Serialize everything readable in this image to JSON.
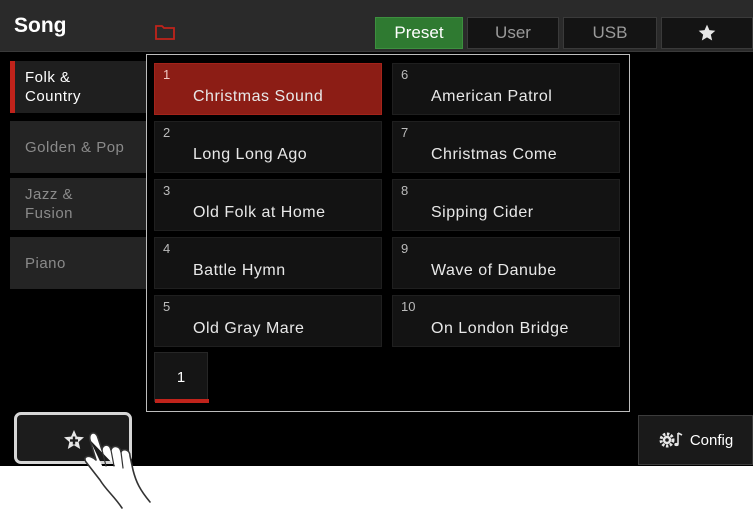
{
  "header": {
    "title": "Song",
    "tabs": [
      {
        "label": "Preset",
        "active": true
      },
      {
        "label": "User",
        "active": false
      },
      {
        "label": "USB",
        "active": false
      }
    ],
    "favorites_icon": "star-icon"
  },
  "categories": [
    {
      "label": "Folk &\nCountry",
      "active": true
    },
    {
      "label": "Golden & Pop",
      "active": false
    },
    {
      "label": "Jazz &\nFusion",
      "active": false
    },
    {
      "label": "Piano",
      "active": false
    }
  ],
  "songs": [
    {
      "number": "1",
      "name": "Christmas Sound",
      "selected": true
    },
    {
      "number": "2",
      "name": "Long Long Ago"
    },
    {
      "number": "3",
      "name": "Old Folk at Home"
    },
    {
      "number": "4",
      "name": "Battle Hymn"
    },
    {
      "number": "5",
      "name": "Old Gray Mare"
    },
    {
      "number": "6",
      "name": "American Patrol"
    },
    {
      "number": "7",
      "name": "Christmas Come"
    },
    {
      "number": "8",
      "name": "Sipping Cider"
    },
    {
      "number": "9",
      "name": "Wave of Danube"
    },
    {
      "number": "10",
      "name": "On London Bridge"
    }
  ],
  "pagination": {
    "current_page": "1"
  },
  "footer": {
    "add_favorite_icon": "star-plus-icon",
    "config_label": "Config",
    "config_icon": "gear-music-icon"
  },
  "colors": {
    "accent_red": "#c0231b",
    "selected_song": "#8c1d15",
    "active_tab": "#2f7a31"
  }
}
